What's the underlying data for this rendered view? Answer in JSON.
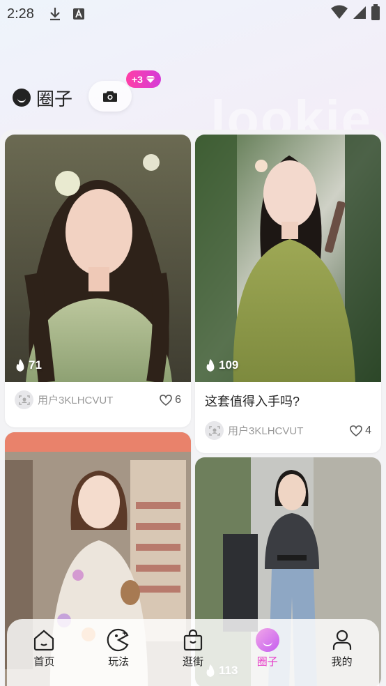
{
  "status_bar": {
    "time": "2:28"
  },
  "header": {
    "title": "圈子",
    "bonus": "+3",
    "watermark": "lookie"
  },
  "posts": [
    {
      "hot": "71",
      "user": "用户3KLHCVUT",
      "likes": "6",
      "title": ""
    },
    {
      "hot": "109",
      "user": "用户3KLHCVUT",
      "likes": "4",
      "title": "这套值得入手吗?"
    },
    {
      "hot": "",
      "user": "",
      "likes": "",
      "title": ""
    },
    {
      "hot": "113",
      "user": "",
      "likes": "",
      "title": ""
    }
  ],
  "tabs": [
    {
      "label": "首页",
      "icon": "home-icon"
    },
    {
      "label": "玩法",
      "icon": "pacman-icon"
    },
    {
      "label": "逛街",
      "icon": "shopping-bag-icon"
    },
    {
      "label": "圈子",
      "icon": "circle-face-icon",
      "active": true
    },
    {
      "label": "我的",
      "icon": "profile-icon"
    }
  ],
  "colors": {
    "accent": "#e63cc8",
    "badge": "#ff3fa6"
  }
}
